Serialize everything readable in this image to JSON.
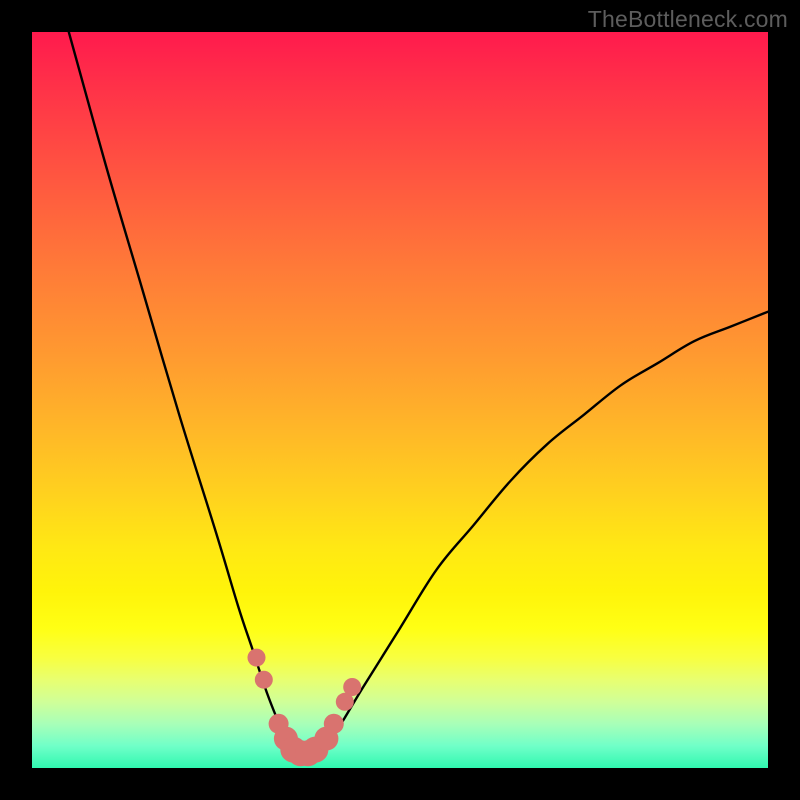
{
  "watermark": "TheBottleneck.com",
  "chart_data": {
    "type": "line",
    "title": "",
    "xlabel": "",
    "ylabel": "",
    "xlim": [
      0,
      100
    ],
    "ylim": [
      0,
      100
    ],
    "series": [
      {
        "name": "bottleneck-curve",
        "x": [
          5,
          10,
          15,
          20,
          25,
          28,
          30,
          32,
          34,
          35,
          36,
          37,
          38,
          39,
          40,
          42,
          45,
          50,
          55,
          60,
          65,
          70,
          75,
          80,
          85,
          90,
          95,
          100
        ],
        "values": [
          100,
          82,
          65,
          48,
          32,
          22,
          16,
          10,
          5,
          3,
          2,
          1.5,
          1.5,
          2,
          3,
          6,
          11,
          19,
          27,
          33,
          39,
          44,
          48,
          52,
          55,
          58,
          60,
          62
        ]
      }
    ],
    "markers": {
      "name": "highlight-dots",
      "x": [
        30.5,
        31.5,
        33.5,
        34.5,
        35.5,
        36.5,
        37.5,
        38.5,
        40,
        41,
        42.5,
        43.5
      ],
      "values": [
        15,
        12,
        6,
        4,
        2.5,
        2,
        2,
        2.5,
        4,
        6,
        9,
        11
      ],
      "sizes": [
        9,
        9,
        10,
        12,
        13,
        13,
        13,
        13,
        12,
        10,
        9,
        9
      ]
    },
    "color_map": "red-yellow-green gradient (vertical, 0=top=red, 100=bottom=green)"
  }
}
